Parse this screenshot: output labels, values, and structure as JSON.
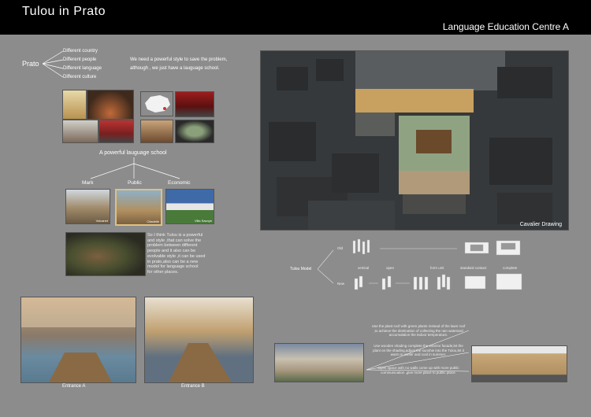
{
  "header": {
    "title": "Tulou  in  Prato",
    "subtitle": "Language Education Centre  A"
  },
  "prato": {
    "label": "Prato",
    "branches": [
      "Different country",
      "Different people",
      "Different language",
      "Different culture"
    ],
    "statement_line1": "We need a powerful style to save the problem,",
    "statement_line2": "although , we just have a lauguage school."
  },
  "school": {
    "heading": "A powerful lauguage school",
    "categories": [
      "Mark",
      "Public",
      "Economic"
    ],
    "image_captions": [
      "Vulcanet",
      "Citadelle",
      "Villa Savoye"
    ]
  },
  "conclusion": {
    "lines": [
      "So I think Tulou is a powerful",
      "and style ,that can solve the",
      "problem between different",
      "people and it also can be",
      "evolvable style ,it can be used",
      " in prato,also can be a new",
      "model for language school",
      " for other places."
    ]
  },
  "cavalier": {
    "caption": "Cavalier Drawing"
  },
  "tulou_model": {
    "label": "Tulou Model",
    "old_label": "Old",
    "new_label": "New",
    "steps": [
      "vertical",
      "open",
      "form unit",
      "standard contact",
      "complete"
    ]
  },
  "entrances": {
    "a": "Entrance A",
    "b": "Entrance B"
  },
  "strategies": [
    "Use the plant roof with green plants instead of the lawn roof ,to achieve the destination of collecting the rain waterand accumulation  the indoor temperature.",
    "Use wooden  shading complete the exterior facade,let the plant on the shading,adjust the sunshie into the Tulou,let it warm in winter and cool in summer.",
    "Open space with no walls come up with more public communication ,give more place to public place."
  ],
  "colors": {
    "background": "#8c8c8c",
    "header": "#000000",
    "tulou_green": "#8fa383"
  }
}
